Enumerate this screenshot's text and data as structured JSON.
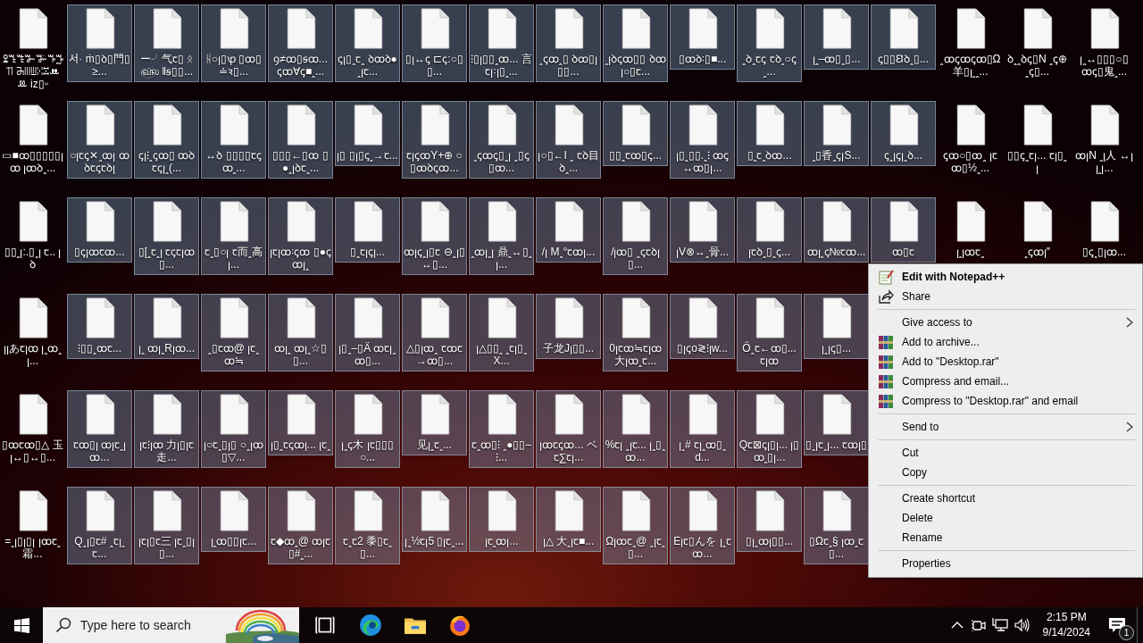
{
  "desktop": {
    "rows": [
      {
        "items": [
          {
            "label": "ꔍꔎꔏꔐꔑꔒꔓꔔ ꔕꔖꔗꔘꔙꔚꔛ iz▯ᵕ",
            "selected": false
          },
          {
            "label": "서· ṁ▯ꝺ▯門▯≥...",
            "selected": true
          },
          {
            "label": "ー╯气ꞇ▯ ᛟ௵ ‖ꞩ▯▯...",
            "selected": true
          },
          {
            "label": "ᚺ○ꞁ▯ꝕ ▯ꝏ▯≐ꝛ▯...",
            "selected": true
          },
          {
            "label": "ꝯ≠ꝏ▯ꞩꝏ... ꞔꝏ∀ꞔ■ꞈ...",
            "selected": true
          },
          {
            "label": "ꞔꞁ▯ꞈꞇꞈ ꝺꝏꝺ●ꞈꞁꞇ...",
            "selected": true
          },
          {
            "label": "▯ꞁ↔ꞔ ⊏ꞔ:○▯▯...",
            "selected": true
          },
          {
            "label": "⁝▯ꞁ▯▯ꞈꝏ... 言ꞇꞁ꞉ꞁ▯ꞈ...",
            "selected": true
          },
          {
            "label": "ꞈꞔꝏꞈ▯ ꝺꝏ▯ꞁ▯▯...",
            "selected": true
          },
          {
            "label": "ꞈꞁꝺꞔꝏ▯▯ ꝺꝏꞁ○▯ꞇ...",
            "selected": true
          },
          {
            "label": "▯ꝏꝺ꞉▯■...",
            "selected": true
          },
          {
            "label": "ꞈꝺꞈꞇꞔ ꞇꝺꞈ○ꞔꞈ...",
            "selected": true
          },
          {
            "label": "ꞁꞈ–ꝏ▯ꞈ▯...",
            "selected": true
          },
          {
            "label": "ꞔ▯▯Ꞛꝺꞈ▯...",
            "selected": true
          },
          {
            "label": "ꞈꝏꞔꝏꞔꝏ▯Ω 羊▯ꞁꞈꞈ...",
            "selected": false
          },
          {
            "label": "ꝺꞈꞈꝺꞔ▯N ꞈꞔ⊕ꞈꞔ▯...",
            "selected": false
          },
          {
            "label": "ꞁꞈ↔▯▯▯○▯ ꝏꞔ▯鬼ꞈ...",
            "selected": false
          }
        ]
      },
      {
        "items": [
          {
            "label": "▭■ꝏ▯▯▯▯▯ꞁ ꝏ ꞁꝏꝺꞈ...",
            "selected": false
          },
          {
            "label": "○ꞁꞇꞔ✕ꞈꝏꞁ ꝏꝺꞇꞔꞇꝺꞁ",
            "selected": true
          },
          {
            "label": "ꞔꞁ⁝ꞈꞔꝏ▯ ꝏꝺꞇꞔꞁꞈ(...",
            "selected": true
          },
          {
            "label": "↔ꝺ ▯▯▯▯ꞇꞔꝏꞈ...",
            "selected": true
          },
          {
            "label": "▯▯▯←▯ꝏ ▯●ꞈꞁꝺꞇꞈ...",
            "selected": true
          },
          {
            "label": "ꞁ▯ ▯ꞁ▯ꞔꞈ→ꞇ...",
            "selected": true
          },
          {
            "label": "ꞇꞁꞔꝏY+⊕ ○▯ꝏꝺꞔꝏ...",
            "selected": true
          },
          {
            "label": "ꞈꞔꝏꞔ▯ꞈꞁ ꞈ▯ꞔ▯ꝏ...",
            "selected": true
          },
          {
            "label": "ꞁ○▯←I ꞈ ꞇꝺ目ꝺꞈ...",
            "selected": true
          },
          {
            "label": "▯▯ꞈꞇꝏ▯ꞔ...",
            "selected": true
          },
          {
            "label": "ꞁ▯ꞈ▯▯.ꞈ⁝ ꝏꞔ↔ꝏ▯ꞁ...",
            "selected": true
          },
          {
            "label": "▯ꞈꞇꞈꝺꝏ...",
            "selected": true
          },
          {
            "label": "ꞈ▯香ꞈꞔꞁS...",
            "selected": true
          },
          {
            "label": "ꞔꞈꞁꞔꞁꞈꝺ...",
            "selected": true
          },
          {
            "label": "ꞔꝏ○▯ꝏꞈ ꞁꞇꝏ▯½ꞈ...",
            "selected": false
          },
          {
            "label": "▯▯ꞔꞈꞇꞁ... ꞇꞁ▯ꞈꞁ",
            "selected": false
          },
          {
            "label": "ꝏꞁN ꞈꞁ人 ↔ꞁ ꞁꞈꞁ...",
            "selected": false
          }
        ]
      },
      {
        "items": [
          {
            "label": "▯▯ꞈꞁ:.▯ꞈꞁ ꞇ.. ꞁꝺ",
            "selected": false
          },
          {
            "label": "▯ꞔꞁꝏꞇꝏ...",
            "selected": true
          },
          {
            "label": "▯[ꞈꞇꞈꞁ ꞇꞔꞇꞁꝏ▯...",
            "selected": true
          },
          {
            "label": "ꞇꞈ▯○ꞁ ꞇ而ꞈ高ꞁ...",
            "selected": true
          },
          {
            "label": "ꞁꞇꞁꝏ꞉ꞔꝏ ▯●ꞔꝏꞁꞈ",
            "selected": true
          },
          {
            "label": "▯ꞈꞇꞁꞔꞁ...",
            "selected": true
          },
          {
            "label": "ꝏꞁꞔꞈꞁ▯ꞇ ⊖ꞈꞁ▯↔▯...",
            "selected": true
          },
          {
            "label": "ꞈꝏꞁꞈꞁ 鼎ꞈ↔▯ꞈꞁ...",
            "selected": true
          },
          {
            "label": "/ꞁ Mꞈ°ꞇꝏꞁ...",
            "selected": true
          },
          {
            "label": "/ꞁꝏ▯ ꞈꞔꞇꝺꞁ▯...",
            "selected": true
          },
          {
            "label": "ꞁV⊗↔ꞈ骨...",
            "selected": true
          },
          {
            "label": "ꞁꞇꝺꞈ▯ꞈꞔ...",
            "selected": true
          },
          {
            "label": "ꝏꞁꞈꞔ№ꞇꝏ...",
            "selected": true
          },
          {
            "label": "ꝏ▯ꞇ",
            "selected": true
          },
          {
            "label": "ꞁꞈꞁꝏꞇꞈ",
            "selected": false
          },
          {
            "label": "ꞈꞔꝏꞁ″",
            "selected": false
          },
          {
            "label": "▯ꞔꞈ▯ꞁꝏ...",
            "selected": false
          }
        ]
      },
      {
        "items": [
          {
            "label": "ꞁꞁあꞇꞁꝏ ꞁꞈꝏꞈꞁ...",
            "selected": false
          },
          {
            "label": "⁝▯▯ꞈꝏꞇ...",
            "selected": true
          },
          {
            "label": "ꞁꞈ ꝏꞁꞈRꞁꝏ...",
            "selected": true
          },
          {
            "label": "ꞈ▯ꞇꝏ@ ꞁꞇꞈꝏ≒",
            "selected": true
          },
          {
            "label": "ꝏꞁꞈ ꝏꞁꞈ☆▯▯...",
            "selected": true
          },
          {
            "label": "ꞁ▯ꞈ–▯Ä ꝏꞇꞁꞈꝏ▯...",
            "selected": true
          },
          {
            "label": "△▯ꞁꝏꞈ ꞇꝏꞇ→ꝏ▯...",
            "selected": true
          },
          {
            "label": "ꞁ△▯▯ꞈ ꞈꞇꞁ▯ꞈX...",
            "selected": true
          },
          {
            "label": "子龙Jꞁ▯▯...",
            "selected": true
          },
          {
            "label": "0ꞁꞇꝏ≒ꞇꞁꝏ 大ꞁꝏꞈꞇ...",
            "selected": true
          },
          {
            "label": "▯ꞁꞔo≷⁝ꞁw...",
            "selected": true
          },
          {
            "label": "Őꞈꞇ←ꝏ▯... ꞇꞁꝏ",
            "selected": true
          },
          {
            "label": "ꞁꞈꞁꞔ▯...",
            "selected": true
          }
        ]
      },
      {
        "items": [
          {
            "label": "▯ꝏꞇꝏ▯△ 玉ꞁ↔▯↔▯...",
            "selected": false
          },
          {
            "label": "ꞇꝏ▯ꞁ ꝏꞁꞇꞈꞁꝏ...",
            "selected": true
          },
          {
            "label": "ꞁꞇ⁝ꞁꝏ 力ꞁ▯ꞁꞇ走...",
            "selected": true
          },
          {
            "label": "ꞁ○ꞇꞈ▯ꞁ▯ ○ꞈꞁꝏ▯▽...",
            "selected": true
          },
          {
            "label": "ꞁ▯ꞈꞇꞔꝏꞁ... ꞁꞇꞈ",
            "selected": true
          },
          {
            "label": "ꞁꞈꞔ木 ꞁꞇ▯▯▯○...",
            "selected": true
          },
          {
            "label": "见ꞁꞈꞇꞈ...",
            "selected": true
          },
          {
            "label": "ꞇꞈꝏ▯⁝ ꞈ●▯▯–⁝...",
            "selected": true
          },
          {
            "label": "ꞁꝏꞇꞔꝏ... ベꞇ∑ꞇꞁ...",
            "selected": true
          },
          {
            "label": "%ꞇꞁ ꞈꞁꞇ... ꞁꞈ▯ꞈꝏ...",
            "selected": true
          },
          {
            "label": "ꞁꞈ# ꞇꞁꞈꝏ▯ꞈd...",
            "selected": true
          },
          {
            "label": "Qꞇ⊠ꞔꞁ▯ꞁ... ꞁ▯ꝏꞈ▯ꞁ...",
            "selected": true
          },
          {
            "label": "▯ꞈꞁꞇꞈꞁ... ꞇꝏꞁ▯",
            "selected": true
          }
        ]
      },
      {
        "items": [
          {
            "label": "=ꞈꞁ▯ꞁ▯ꞁ ꞁꝏꞇꞈ霜...",
            "selected": false
          },
          {
            "label": "Qꞈꞁ▯ꞇ# ꞈꞇꞁꞈꞇ...",
            "selected": true
          },
          {
            "label": "ꞁꞇꞁ▯ꞇ三 ꞁꞇꞈ▯ꞁ▯...",
            "selected": true
          },
          {
            "label": "ꞁꞈꝏ▯▯ꞁꞇ...",
            "selected": true
          },
          {
            "label": "ꞇ◆ꝏꞈ@ ꝏꞁꞇ▯#ꞈ...",
            "selected": true
          },
          {
            "label": "ꞇꞈꞇ2 黍▯ꞇꞈ▯...",
            "selected": true
          },
          {
            "label": "ꞁꞈ½ꞇꞁ5 ▯ꞁꞇꞈ...",
            "selected": true
          },
          {
            "label": "ꞁꞇꞈꝏꞁ...",
            "selected": true
          },
          {
            "label": "ꞁ△ 大ꞈꞁꞇ■...",
            "selected": true
          },
          {
            "label": "Ωꞁꝏꞇꞈ@ ꞈꞁꞇꞈ▯...",
            "selected": true
          },
          {
            "label": "Eꞁꞇ▯んを ꞁꞈꞇꝏ...",
            "selected": true
          },
          {
            "label": "▯ꞁꞈꝏꞁ▯▯...",
            "selected": true
          },
          {
            "label": "▯Ωꞇꞈ§ ꞁꝏꞈꞇ▯...",
            "selected": true
          }
        ]
      }
    ]
  },
  "context_menu": {
    "items": [
      {
        "kind": "notepad",
        "label": "Edit with Notepad++",
        "bold": true
      },
      {
        "kind": "share",
        "label": "Share"
      },
      {
        "kind": "separator"
      },
      {
        "kind": "submenu",
        "label": "Give access to"
      },
      {
        "kind": "archive",
        "label": "Add to archive..."
      },
      {
        "kind": "archive",
        "label": "Add to \"Desktop.rar\""
      },
      {
        "kind": "archive",
        "label": "Compress and email..."
      },
      {
        "kind": "archive",
        "label": "Compress to \"Desktop.rar\" and email"
      },
      {
        "kind": "separator"
      },
      {
        "kind": "submenu",
        "label": "Send to"
      },
      {
        "kind": "separator"
      },
      {
        "kind": "item",
        "label": "Cut"
      },
      {
        "kind": "item",
        "label": "Copy"
      },
      {
        "kind": "separator"
      },
      {
        "kind": "item",
        "label": "Create shortcut"
      },
      {
        "kind": "item",
        "label": "Delete"
      },
      {
        "kind": "item",
        "label": "Rename"
      },
      {
        "kind": "separator"
      },
      {
        "kind": "item",
        "label": "Properties"
      }
    ]
  },
  "taskbar": {
    "search": {
      "placeholder": "Type here to search"
    },
    "apps": [
      {
        "kind": "task-view"
      },
      {
        "kind": "edge"
      },
      {
        "kind": "explorer"
      },
      {
        "kind": "firefox"
      }
    ],
    "tray": [
      {
        "kind": "chevron"
      },
      {
        "kind": "meet"
      },
      {
        "kind": "network"
      },
      {
        "kind": "volume"
      }
    ],
    "clock": {
      "time": "2:15 PM",
      "date": "9/14/2024"
    },
    "notifications": {
      "count": "1"
    }
  }
}
